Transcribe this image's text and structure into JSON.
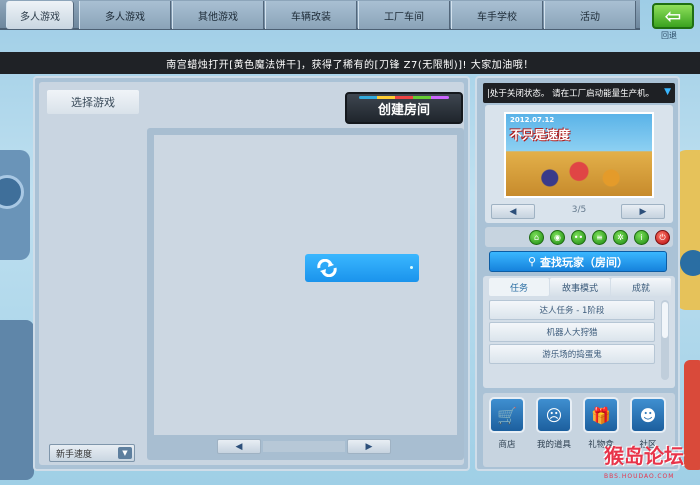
{
  "tabs": [
    {
      "label": "多人游戏",
      "active": true
    },
    {
      "label": "多人游戏",
      "active": false
    },
    {
      "label": "其他游戏",
      "active": false
    },
    {
      "label": "车辆改装",
      "active": false
    },
    {
      "label": "工厂车间",
      "active": false
    },
    {
      "label": "车手学校",
      "active": false
    },
    {
      "label": "活动",
      "active": false
    }
  ],
  "back": {
    "icon": "back-arrow-icon",
    "label": "回退"
  },
  "announcement": "南宫蜡烛打开[黄色魔法饼干]，获得了稀有的[刀锋 Z7(无限制)]! 大家加油哦！",
  "left_panel": {
    "select_game_label": "选择游戏",
    "create_room_label": "创建房间",
    "refresh_icon": "refresh-icon",
    "speed_select_value": "新手速度",
    "pager_prev": "◀",
    "pager_next": "▶"
  },
  "right_panel": {
    "status_text": "|处于关闭状态。 请在工厂启动能量生产机。",
    "banner": {
      "date": "2012.07.12",
      "title": "不只是速度",
      "page": "3/5",
      "prev": "◀",
      "next": "▶"
    },
    "quick_icons": [
      "home-icon",
      "power-icon",
      "link-icon",
      "list-icon",
      "gear-icon",
      "info-icon",
      "shutdown-icon"
    ],
    "find_player_label": "查找玩家（房间）",
    "task_tabs": [
      "任务",
      "故事模式",
      "成就"
    ],
    "task_items": [
      "达人任务 - 1阶段",
      "机器人大狩猎",
      "游乐场的捣蛋鬼"
    ],
    "shop": [
      {
        "label": "商店",
        "icon": "cart-icon"
      },
      {
        "label": "我的道具",
        "icon": "crying-face-icon"
      },
      {
        "label": "礼物盒",
        "icon": "gift-icon"
      },
      {
        "label": "社区",
        "icon": "mascot-icon"
      }
    ]
  },
  "watermark": {
    "text": "猴岛论坛",
    "url": "BBS.HOUDAO.COM"
  }
}
